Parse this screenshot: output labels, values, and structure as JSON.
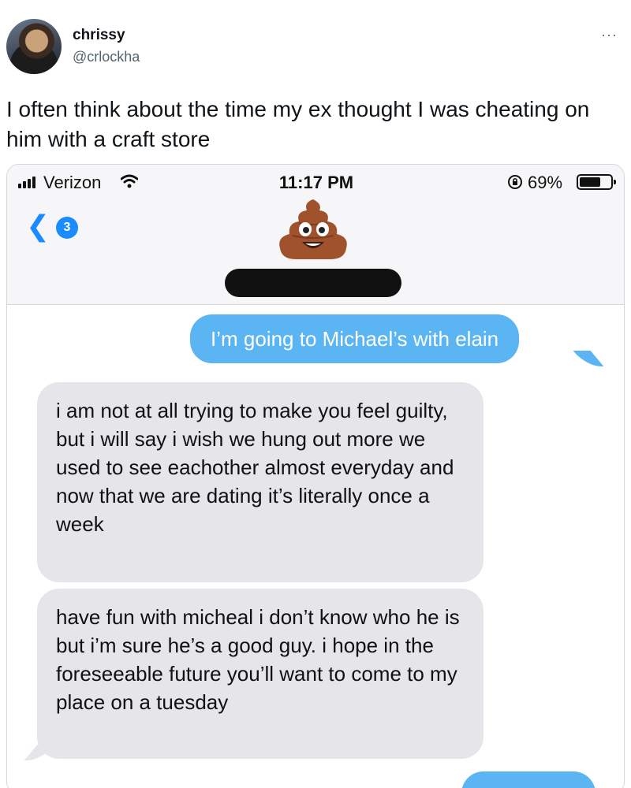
{
  "tweet": {
    "display_name": "chrissy",
    "handle": "@crlockha",
    "more_icon": "more-dots-icon",
    "more_glyph": "···",
    "text": "I often think about the time my ex thought I was cheating on him with a craft store"
  },
  "status_bar": {
    "carrier": "Verizon",
    "time": "11:17 PM",
    "battery_percent": "69%",
    "battery_level": 0.69
  },
  "chat_header": {
    "back_count": "3",
    "contact_icon": "pile-of-poo-emoji"
  },
  "messages": [
    {
      "direction": "sent",
      "text": "I’m going to Michael’s with elain"
    },
    {
      "direction": "received",
      "text": "i am not at all trying to make you feel guilty, but i will say i wish we hung out more we used to see eachother almost everyday and now that we are dating it’s literally once a week"
    },
    {
      "direction": "received",
      "text": "have fun with micheal i don’t know who he is but i’m sure he’s a good guy. i hope in the foreseeable future you’ll want to come to my place on a tuesday"
    }
  ],
  "colors": {
    "sent_bubble": "#5ab5f2",
    "received_bubble": "#e5e5ea",
    "ios_blue": "#1a8cff"
  }
}
